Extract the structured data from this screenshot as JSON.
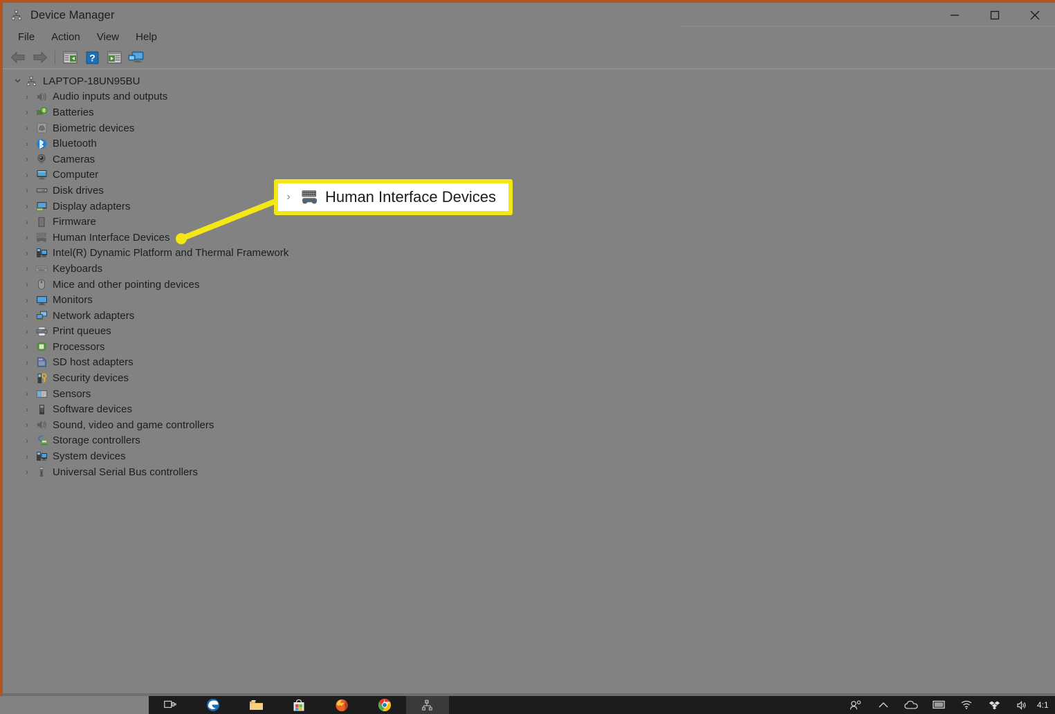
{
  "window": {
    "title": "Device Manager",
    "icon": "device-manager-icon",
    "controls": {
      "minimize": "Minimize",
      "maximize": "Maximize",
      "close": "Close"
    }
  },
  "menu": {
    "items": [
      {
        "label": "File",
        "name": "menu-file"
      },
      {
        "label": "Action",
        "name": "menu-action"
      },
      {
        "label": "View",
        "name": "menu-view"
      },
      {
        "label": "Help",
        "name": "menu-help"
      }
    ]
  },
  "toolbar": {
    "buttons": [
      {
        "name": "back-button",
        "icon": "arrow-left-icon",
        "tooltip": "Back"
      },
      {
        "name": "forward-button",
        "icon": "arrow-right-icon",
        "tooltip": "Forward"
      },
      {
        "name": "show-hide-console-tree-button",
        "icon": "console-tree-icon",
        "tooltip": "Show/Hide Console Tree"
      },
      {
        "name": "help-button",
        "icon": "help-question-icon",
        "tooltip": "Help"
      },
      {
        "name": "properties-button",
        "icon": "properties-icon",
        "tooltip": "Properties"
      },
      {
        "name": "scan-hardware-changes-button",
        "icon": "monitor-scan-icon",
        "tooltip": "Scan for hardware changes"
      }
    ]
  },
  "tree": {
    "root": {
      "label": "LAPTOP-18UN95BU",
      "icon": "computer-root-icon",
      "expanded": true,
      "twisty": "v"
    },
    "twisty_collapsed": "›",
    "items": [
      {
        "label": "Audio inputs and outputs",
        "icon": "speaker-icon",
        "name": "tree-item-audio-inputs-and-outputs"
      },
      {
        "label": "Batteries",
        "icon": "battery-icon",
        "name": "tree-item-batteries"
      },
      {
        "label": "Biometric devices",
        "icon": "fingerprint-icon",
        "name": "tree-item-biometric-devices"
      },
      {
        "label": "Bluetooth",
        "icon": "bluetooth-icon",
        "name": "tree-item-bluetooth"
      },
      {
        "label": "Cameras",
        "icon": "camera-icon",
        "name": "tree-item-cameras"
      },
      {
        "label": "Computer",
        "icon": "computer-icon",
        "name": "tree-item-computer"
      },
      {
        "label": "Disk drives",
        "icon": "disk-drive-icon",
        "name": "tree-item-disk-drives"
      },
      {
        "label": "Display adapters",
        "icon": "display-adapter-icon",
        "name": "tree-item-display-adapters"
      },
      {
        "label": "Firmware",
        "icon": "firmware-icon",
        "name": "tree-item-firmware"
      },
      {
        "label": "Human Interface Devices",
        "icon": "hid-icon",
        "name": "tree-item-human-interface-devices"
      },
      {
        "label": "Intel(R) Dynamic Platform and Thermal Framework",
        "icon": "thermal-framework-icon",
        "name": "tree-item-intel-dynamic-platform"
      },
      {
        "label": "Keyboards",
        "icon": "keyboard-icon",
        "name": "tree-item-keyboards"
      },
      {
        "label": "Mice and other pointing devices",
        "icon": "mouse-icon",
        "name": "tree-item-mice"
      },
      {
        "label": "Monitors",
        "icon": "monitor-icon",
        "name": "tree-item-monitors"
      },
      {
        "label": "Network adapters",
        "icon": "network-adapter-icon",
        "name": "tree-item-network-adapters"
      },
      {
        "label": "Print queues",
        "icon": "printer-icon",
        "name": "tree-item-print-queues"
      },
      {
        "label": "Processors",
        "icon": "processor-icon",
        "name": "tree-item-processors"
      },
      {
        "label": "SD host adapters",
        "icon": "sd-card-icon",
        "name": "tree-item-sd-host-adapters"
      },
      {
        "label": "Security devices",
        "icon": "security-key-icon",
        "name": "tree-item-security-devices"
      },
      {
        "label": "Sensors",
        "icon": "sensor-icon",
        "name": "tree-item-sensors"
      },
      {
        "label": "Software devices",
        "icon": "software-device-icon",
        "name": "tree-item-software-devices"
      },
      {
        "label": "Sound, video and game controllers",
        "icon": "sound-icon",
        "name": "tree-item-sound-video-game-controllers"
      },
      {
        "label": "Storage controllers",
        "icon": "storage-controller-icon",
        "name": "tree-item-storage-controllers"
      },
      {
        "label": "System devices",
        "icon": "system-device-icon",
        "name": "tree-item-system-devices"
      },
      {
        "label": "Universal Serial Bus controllers",
        "icon": "usb-icon",
        "name": "tree-item-usb-controllers"
      }
    ]
  },
  "callout": {
    "label": "Human Interface Devices",
    "twisty": "›",
    "icon": "hid-icon",
    "border_color": "#f5e616",
    "background_color": "#ffffff",
    "pointer_color": "#f5e616"
  },
  "taskbar": {
    "items": [
      {
        "name": "taskbar-task-view",
        "icon": "task-view-icon",
        "active": false
      },
      {
        "name": "taskbar-edge",
        "icon": "edge-icon",
        "active": false
      },
      {
        "name": "taskbar-file-explorer",
        "icon": "folder-icon",
        "active": false
      },
      {
        "name": "taskbar-microsoft-store",
        "icon": "store-bag-icon",
        "active": false
      },
      {
        "name": "taskbar-firefox",
        "icon": "firefox-icon",
        "active": false
      },
      {
        "name": "taskbar-chrome",
        "icon": "chrome-icon",
        "active": false
      },
      {
        "name": "taskbar-device-manager",
        "icon": "device-manager-icon",
        "active": true
      }
    ],
    "tray": [
      {
        "name": "tray-people-icon",
        "icon": "people-icon"
      },
      {
        "name": "tray-show-hidden-icons",
        "icon": "chevron-up-icon"
      },
      {
        "name": "tray-onedrive-icon",
        "icon": "cloud-icon"
      },
      {
        "name": "tray-display-icon",
        "icon": "display-tray-icon"
      },
      {
        "name": "tray-network-icon",
        "icon": "wifi-icon"
      },
      {
        "name": "tray-dropbox-icon",
        "icon": "dropbox-icon"
      },
      {
        "name": "tray-volume-icon",
        "icon": "volume-icon"
      }
    ],
    "clock": "4:1"
  },
  "colors": {
    "window_chrome": "#828282",
    "accent_border": "#b4551f",
    "highlight_yellow": "#f5e616",
    "taskbar": "#1c1c1c"
  }
}
